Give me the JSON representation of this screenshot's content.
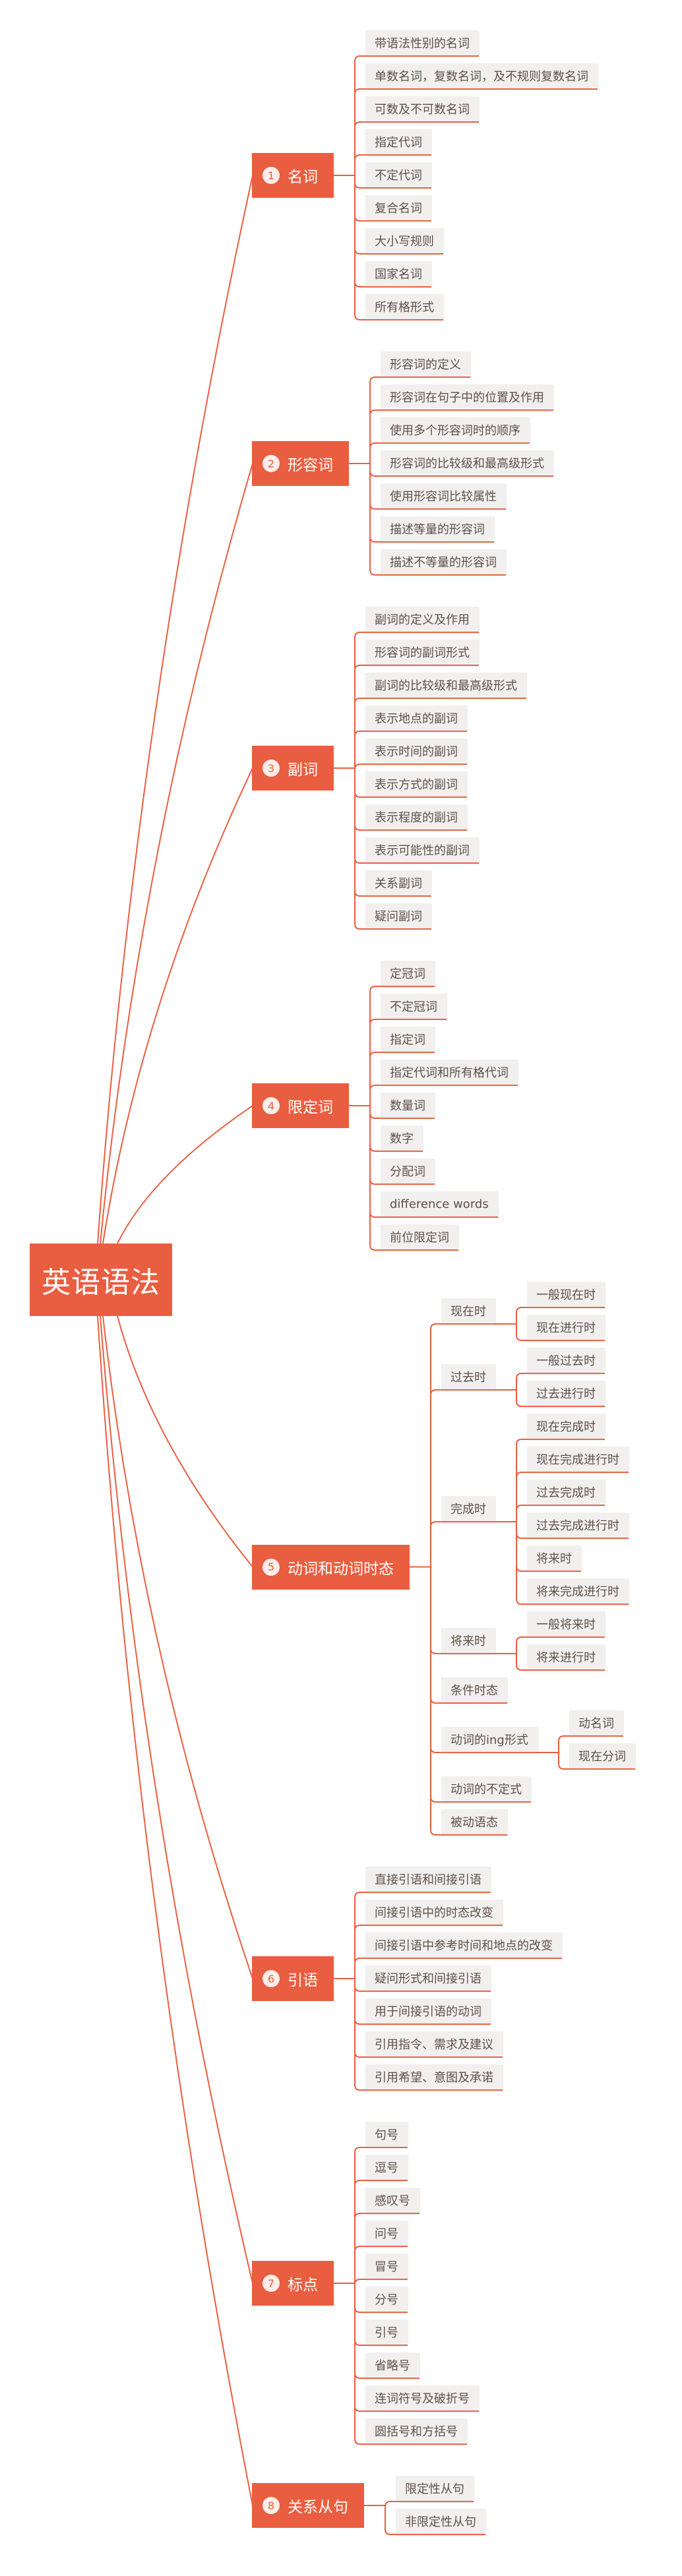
{
  "title": "英语语法",
  "colors": {
    "accent": "#E95E40",
    "leaf_bg": "#f1f0ef",
    "leaf_text": "#5e5048"
  },
  "topics": [
    {
      "num": "1",
      "label": "名词",
      "children": [
        {
          "label": "带语法性别的名词"
        },
        {
          "label": "单数名词，复数名词，及不规则复数名词"
        },
        {
          "label": "可数及不可数名词"
        },
        {
          "label": "指定代词"
        },
        {
          "label": "不定代词"
        },
        {
          "label": "复合名词"
        },
        {
          "label": "大小写规则"
        },
        {
          "label": "国家名词"
        },
        {
          "label": "所有格形式"
        }
      ]
    },
    {
      "num": "2",
      "label": "形容词",
      "children": [
        {
          "label": "形容词的定义"
        },
        {
          "label": "形容词在句子中的位置及作用"
        },
        {
          "label": "使用多个形容词时的顺序"
        },
        {
          "label": "形容词的比较级和最高级形式"
        },
        {
          "label": "使用形容词比较属性"
        },
        {
          "label": "描述等量的形容词"
        },
        {
          "label": "描述不等量的形容词"
        }
      ]
    },
    {
      "num": "3",
      "label": "副词",
      "children": [
        {
          "label": "副词的定义及作用"
        },
        {
          "label": "形容词的副词形式"
        },
        {
          "label": "副词的比较级和最高级形式"
        },
        {
          "label": "表示地点的副词"
        },
        {
          "label": "表示时间的副词"
        },
        {
          "label": "表示方式的副词"
        },
        {
          "label": "表示程度的副词"
        },
        {
          "label": "表示可能性的副词"
        },
        {
          "label": "关系副词"
        },
        {
          "label": "疑问副词"
        }
      ]
    },
    {
      "num": "4",
      "label": "限定词",
      "children": [
        {
          "label": "定冠词"
        },
        {
          "label": "不定冠词"
        },
        {
          "label": "指定词"
        },
        {
          "label": "指定代词和所有格代词"
        },
        {
          "label": "数量词"
        },
        {
          "label": "数字"
        },
        {
          "label": "分配词"
        },
        {
          "label": "difference words"
        },
        {
          "label": "前位限定词"
        }
      ]
    },
    {
      "num": "5",
      "label": "动词和动词时态",
      "children": [
        {
          "label": "现在时",
          "children": [
            {
              "label": "一般现在时"
            },
            {
              "label": "现在进行时"
            }
          ]
        },
        {
          "label": "过去时",
          "children": [
            {
              "label": "一般过去时"
            },
            {
              "label": "过去进行时"
            }
          ]
        },
        {
          "label": "完成时",
          "children": [
            {
              "label": "现在完成时"
            },
            {
              "label": "现在完成进行时"
            },
            {
              "label": "过去完成时"
            },
            {
              "label": "过去完成进行时"
            },
            {
              "label": "将来时"
            },
            {
              "label": "将来完成进行时"
            }
          ]
        },
        {
          "label": "将来时",
          "children": [
            {
              "label": "一般将来时"
            },
            {
              "label": "将来进行时"
            }
          ]
        },
        {
          "label": "条件时态"
        },
        {
          "label": "动词的ing形式",
          "children": [
            {
              "label": "动名词"
            },
            {
              "label": "现在分词"
            }
          ]
        },
        {
          "label": "动词的不定式"
        },
        {
          "label": "被动语态"
        }
      ]
    },
    {
      "num": "6",
      "label": "引语",
      "children": [
        {
          "label": "直接引语和间接引语"
        },
        {
          "label": "间接引语中的时态改变"
        },
        {
          "label": "间接引语中参考时间和地点的改变"
        },
        {
          "label": "疑问形式和间接引语"
        },
        {
          "label": "用于间接引语的动词"
        },
        {
          "label": "引用指令、需求及建议"
        },
        {
          "label": "引用希望、意图及承诺"
        }
      ]
    },
    {
      "num": "7",
      "label": "标点",
      "children": [
        {
          "label": "句号"
        },
        {
          "label": "逗号"
        },
        {
          "label": "感叹号"
        },
        {
          "label": "问号"
        },
        {
          "label": "冒号"
        },
        {
          "label": "分号"
        },
        {
          "label": "引号"
        },
        {
          "label": "省略号"
        },
        {
          "label": "连词符号及破折号"
        },
        {
          "label": "圆括号和方括号"
        }
      ]
    },
    {
      "num": "8",
      "label": "关系从句",
      "children": [
        {
          "label": "限定性从句"
        },
        {
          "label": "非限定性从句"
        }
      ]
    }
  ]
}
